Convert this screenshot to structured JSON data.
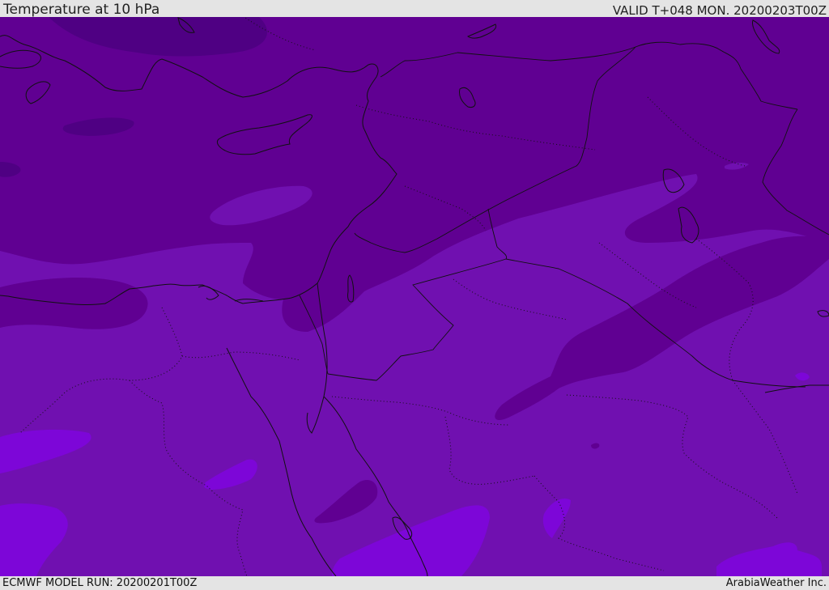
{
  "header": {
    "title": "Temperature at 10 hPa",
    "valid": "VALID T+048 MON. 20200203T00Z"
  },
  "footer": {
    "model_run": "ECMWF MODEL RUN: 20200201T00Z",
    "credit": "ArabiaWeather Inc."
  },
  "map": {
    "colors": {
      "darkest": "#4f0083",
      "dark": "#600092",
      "medium": "#7010b0",
      "light": "#7d06d8",
      "coastline": "#111111",
      "border": "#111111"
    }
  }
}
